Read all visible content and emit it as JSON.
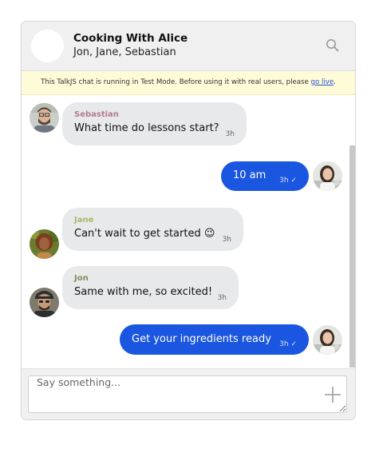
{
  "header": {
    "title": "Cooking With Alice",
    "subtitle": "Jon, Jane, Sebastian",
    "search_icon": "search-icon"
  },
  "banner": {
    "text": "This TalkJS chat is running in Test Mode. Before using it with real users, please ",
    "link_text": "go live",
    "suffix": "."
  },
  "messages": [
    {
      "sender": "Sebastian",
      "sender_color": "#b37b92",
      "text": "What time do lessons start?",
      "time": "3h",
      "outgoing": false,
      "avatar": "sebastian-avatar"
    },
    {
      "sender": "",
      "text": "10 am",
      "time": "3h ✓",
      "outgoing": true,
      "avatar": "alice-avatar"
    },
    {
      "sender": "Jane",
      "sender_color": "#aab86a",
      "text": "Can't wait to get started 😉",
      "time": "3h",
      "outgoing": false,
      "avatar": "jane-avatar"
    },
    {
      "sender": "Jon",
      "sender_color": "#8a8a5a",
      "text": "Same with me, so excited!",
      "time": "3h",
      "outgoing": false,
      "avatar": "jon-avatar"
    },
    {
      "sender": "",
      "text": "Get your ingredients ready",
      "time": "3h ✓",
      "outgoing": true,
      "avatar": "alice-avatar"
    }
  ],
  "composer": {
    "placeholder": "Say something...",
    "send_icon": "plus-icon"
  },
  "colors": {
    "accent": "#1a56e0",
    "incoming_bubble": "#e7e9eb",
    "banner_bg": "#fefbd9",
    "header_bg": "#f0f0f0"
  }
}
